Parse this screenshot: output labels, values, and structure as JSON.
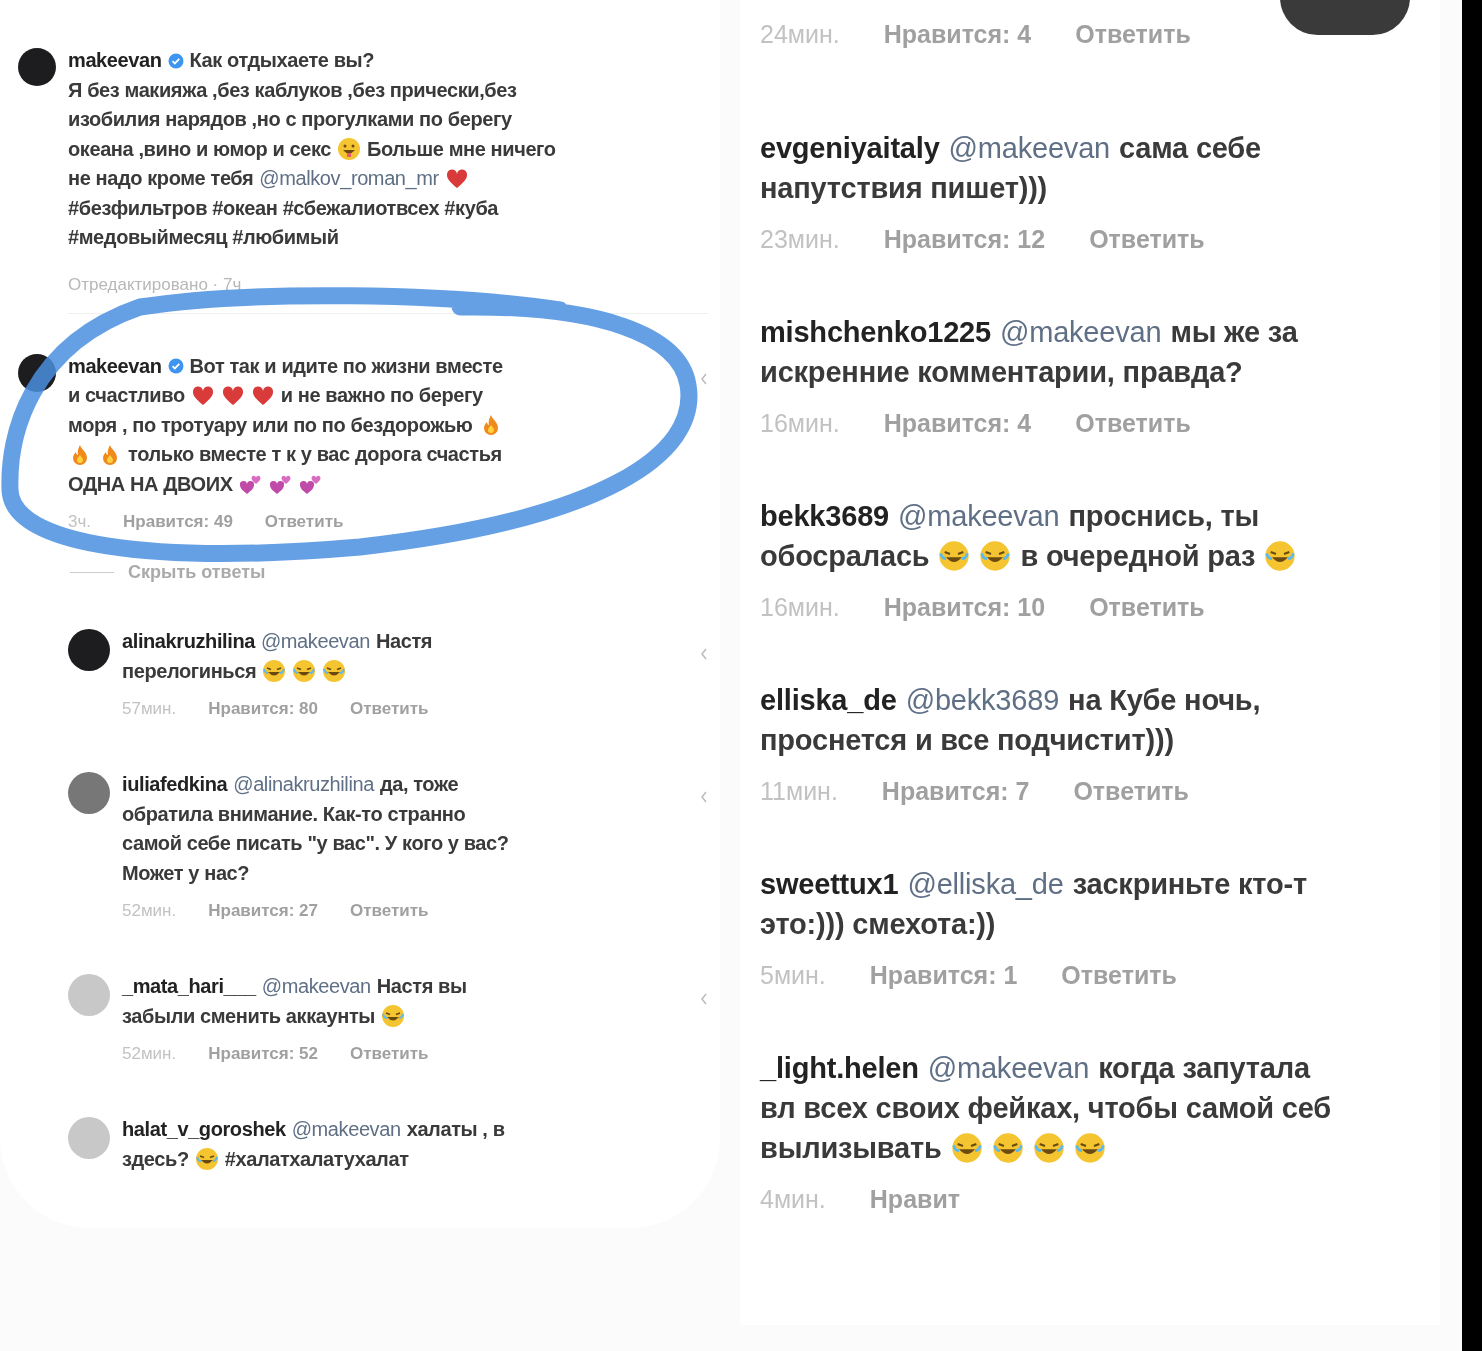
{
  "left_panel": {
    "comments": [
      {
        "user": "makeevan",
        "verified": true,
        "arrow": false,
        "lines": [
          [
            {
              "kind": "text",
              "text": "Как отдыхаете вы?"
            }
          ],
          [
            {
              "kind": "text",
              "text": "Я без макияжа ,без каблуков ,без прически,без"
            }
          ],
          [
            {
              "kind": "text",
              "text": "изобилия нарядов ,но с прогулками по берегу"
            }
          ],
          [
            {
              "kind": "text",
              "text": "океана ,вино и юмор и секс"
            },
            {
              "kind": "grin"
            },
            {
              "kind": "text",
              "text": "Больше мне ничего"
            }
          ],
          [
            {
              "kind": "text",
              "text": "не надо кроме тебя"
            },
            {
              "kind": "mention",
              "text": "@malkov_roman_mr"
            },
            {
              "kind": "heart"
            }
          ],
          [
            {
              "kind": "text",
              "text": "#безфильтров #океан #сбежалиотвсех #куба"
            }
          ],
          [
            {
              "kind": "text",
              "text": "#медовыймесяц #любимый"
            }
          ]
        ],
        "edited": "Отредактировано · 7ч"
      },
      {
        "user": "makeevan",
        "verified": true,
        "arrow": true,
        "lines": [
          [
            {
              "kind": "text",
              "text": "Вот так и идите по жизни вместе"
            }
          ],
          [
            {
              "kind": "text",
              "text": "и счастливо"
            },
            {
              "kind": "heart"
            },
            {
              "kind": "heart"
            },
            {
              "kind": "heart"
            },
            {
              "kind": "text",
              "text": "и не важно по берегу"
            }
          ],
          [
            {
              "kind": "text",
              "text": "моря , по тротуару или по по бездорожью"
            },
            {
              "kind": "fire"
            }
          ],
          [
            {
              "kind": "fire"
            },
            {
              "kind": "fire"
            },
            {
              "kind": "text",
              "text": "только вместе т к у вас дорога счастья"
            }
          ],
          [
            {
              "kind": "text",
              "text": "ОДНА  НА ДВОИХ"
            },
            {
              "kind": "hearts"
            },
            {
              "kind": "hearts"
            },
            {
              "kind": "hearts"
            }
          ]
        ],
        "meta": {
          "time": "3ч.",
          "likes": "Нравится: 49",
          "reply": "Ответить"
        }
      }
    ],
    "hide_replies": "Скрыть ответы",
    "replies": [
      {
        "user": "alinakruzhilina",
        "arrow": true,
        "lines": [
          [
            {
              "kind": "mention",
              "text": "@makeevan"
            },
            {
              "kind": "text",
              "text": "Настя"
            }
          ],
          [
            {
              "kind": "text",
              "text": "перелогинься"
            },
            {
              "kind": "laugh"
            },
            {
              "kind": "laugh"
            },
            {
              "kind": "laugh"
            }
          ]
        ],
        "meta": {
          "time": "57мин.",
          "likes": "Нравится: 80",
          "reply": "Ответить"
        }
      },
      {
        "user": "iuliafedkina",
        "arrow": true,
        "lines": [
          [
            {
              "kind": "mention",
              "text": "@alinakruzhilina"
            },
            {
              "kind": "text",
              "text": "да, тоже"
            }
          ],
          [
            {
              "kind": "text",
              "text": "обратила внимание. Как-то странно"
            }
          ],
          [
            {
              "kind": "text",
              "text": "самой себе писать \"у вас\". У кого у вас?"
            }
          ],
          [
            {
              "kind": "text",
              "text": "Может у нас?"
            }
          ]
        ],
        "meta": {
          "time": "52мин.",
          "likes": "Нравится: 27",
          "reply": "Ответить"
        }
      },
      {
        "user": "_mata_hari___",
        "arrow": true,
        "lines": [
          [
            {
              "kind": "mention",
              "text": "@makeevan"
            },
            {
              "kind": "text",
              "text": "Настя вы"
            }
          ],
          [
            {
              "kind": "text",
              "text": "забыли сменить аккаунты"
            },
            {
              "kind": "laugh"
            }
          ]
        ],
        "meta": {
          "time": "52мин.",
          "likes": "Нравится: 52",
          "reply": "Ответить"
        }
      },
      {
        "user": "halat_v_goroshek",
        "arrow": false,
        "lines": [
          [
            {
              "kind": "mention",
              "text": "@makeevan"
            },
            {
              "kind": "text",
              "text": "халаты , в"
            }
          ],
          [
            {
              "kind": "text",
              "text": "здесь?"
            },
            {
              "kind": "laugh"
            },
            {
              "kind": "text",
              "text": "#халатхалатухалат"
            }
          ]
        ]
      }
    ]
  },
  "right_panel": {
    "comments": [
      {
        "meta": {
          "time": "24мин.",
          "likes": "Нравится: 4",
          "reply": "Ответить"
        }
      },
      {
        "user": "evgeniyaitaly",
        "lines": [
          [
            {
              "kind": "mention",
              "text": "@makeevan"
            },
            {
              "kind": "text",
              "text": "сама себе"
            }
          ],
          [
            {
              "kind": "text",
              "text": "напутствия пишет)))"
            }
          ]
        ],
        "meta": {
          "time": "23мин.",
          "likes": "Нравится: 12",
          "reply": "Ответить"
        }
      },
      {
        "user": "mishchenko1225",
        "lines": [
          [
            {
              "kind": "mention",
              "text": "@makeevan"
            },
            {
              "kind": "text",
              "text": "мы же за"
            }
          ],
          [
            {
              "kind": "text",
              "text": "искренние комментарии, правда?"
            }
          ]
        ],
        "meta": {
          "time": "16мин.",
          "likes": "Нравится: 4",
          "reply": "Ответить"
        }
      },
      {
        "user": "bekk3689",
        "lines": [
          [
            {
              "kind": "mention",
              "text": "@makeevan"
            },
            {
              "kind": "text",
              "text": "проснись, ты"
            }
          ],
          [
            {
              "kind": "text",
              "text": "обосралась"
            },
            {
              "kind": "laugh"
            },
            {
              "kind": "laugh"
            },
            {
              "kind": "text",
              "text": "в очередной раз"
            },
            {
              "kind": "laugh"
            }
          ]
        ],
        "meta": {
          "time": "16мин.",
          "likes": "Нравится: 10",
          "reply": "Ответить"
        }
      },
      {
        "user": "elliska_de",
        "lines": [
          [
            {
              "kind": "mention",
              "text": "@bekk3689"
            },
            {
              "kind": "text",
              "text": "на Кубе ночь,"
            }
          ],
          [
            {
              "kind": "text",
              "text": "проснется и все подчистит)))"
            }
          ]
        ],
        "meta": {
          "time": "11мин.",
          "likes": "Нравится: 7",
          "reply": "Ответить"
        }
      },
      {
        "user": "sweettux1",
        "lines": [
          [
            {
              "kind": "mention",
              "text": "@elliska_de"
            },
            {
              "kind": "text",
              "text": "заскриньте кто-т"
            }
          ],
          [
            {
              "kind": "text",
              "text": "это:))) смехота:))"
            }
          ]
        ],
        "meta": {
          "time": "5мин.",
          "likes": "Нравится: 1",
          "reply": "Ответить"
        }
      },
      {
        "user": "_light.helen",
        "lines": [
          [
            {
              "kind": "mention",
              "text": "@makeevan"
            },
            {
              "kind": "text",
              "text": "когда запутала"
            }
          ],
          [
            {
              "kind": "text",
              "text": "вл всех своих фейках, чтобы самой себ"
            }
          ],
          [
            {
              "kind": "text",
              "text": "вылизывать"
            },
            {
              "kind": "laugh"
            },
            {
              "kind": "laugh"
            },
            {
              "kind": "laugh"
            },
            {
              "kind": "laugh"
            }
          ]
        ],
        "meta": {
          "time": "4мин.",
          "likes": "Нравит"
        }
      }
    ]
  }
}
